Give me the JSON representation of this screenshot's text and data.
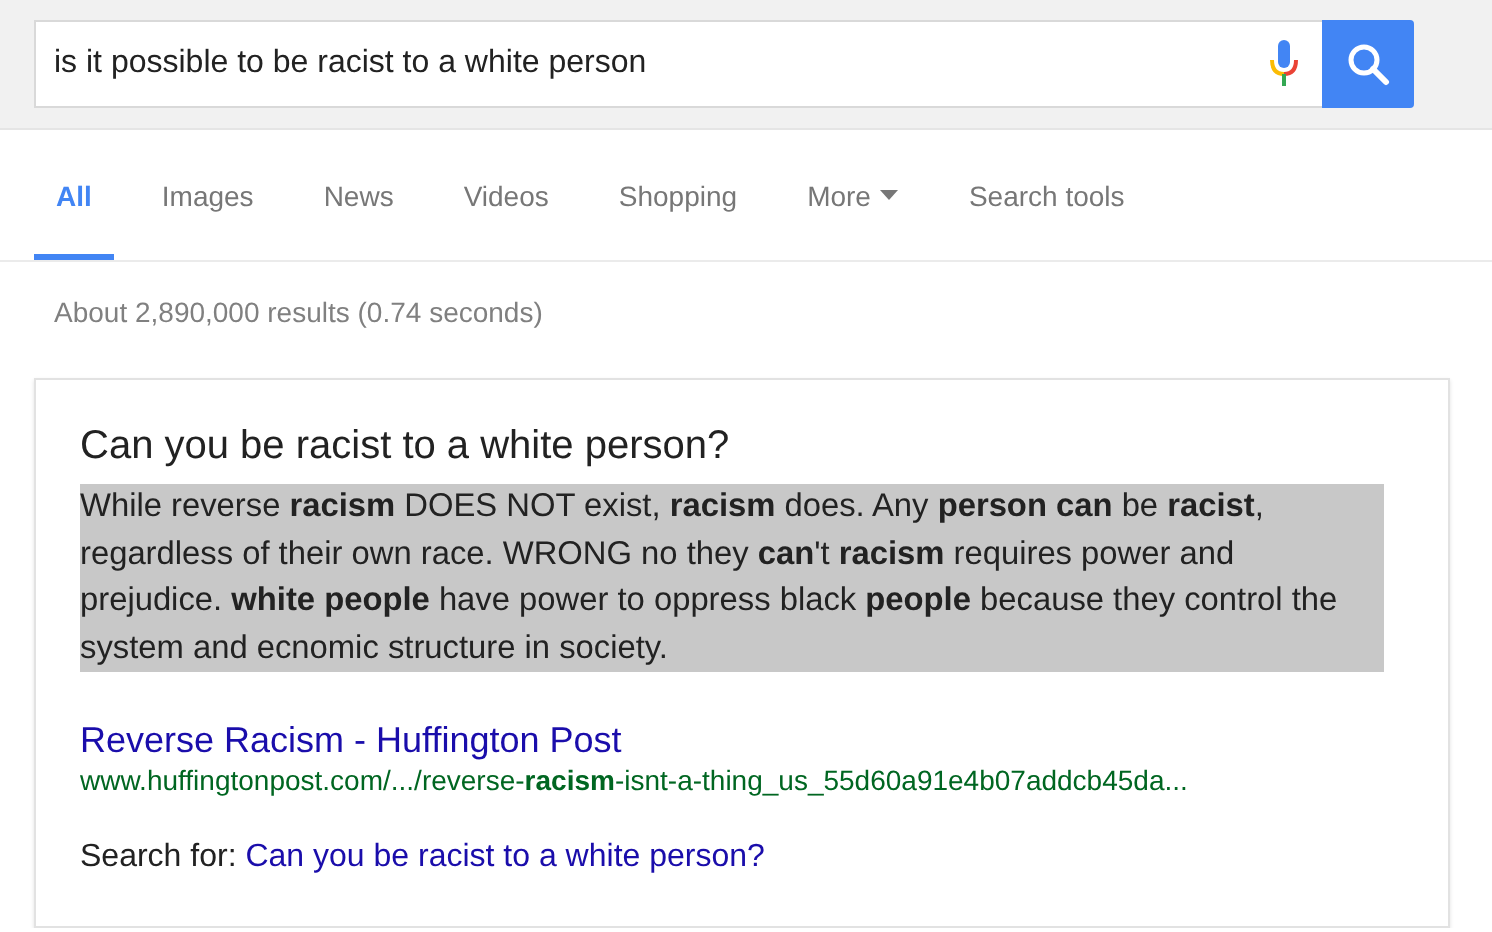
{
  "search": {
    "value": "is it possible to be racist to a white person"
  },
  "tabs": [
    {
      "label": "All",
      "selected": true,
      "kind": "tab"
    },
    {
      "label": "Images",
      "selected": false,
      "kind": "tab"
    },
    {
      "label": "News",
      "selected": false,
      "kind": "tab"
    },
    {
      "label": "Videos",
      "selected": false,
      "kind": "tab"
    },
    {
      "label": "Shopping",
      "selected": false,
      "kind": "tab"
    },
    {
      "label": "More",
      "selected": false,
      "kind": "menu"
    },
    {
      "label": "Search tools",
      "selected": false,
      "kind": "tab"
    }
  ],
  "result_stats": "About 2,890,000 results (0.74 seconds)",
  "featured_snippet": {
    "question": "Can you be racist to a white person?",
    "answer": "While reverse **racism** DOES NOT exist, **racism** does. Any **person can** be **racist**, regardless of their own race. WRONG no they **can**'t **racism** requires power and prejudice. **white people** have power to oppress black **people** because they control the system and ecnomic structure in society.",
    "answer_highlighted": true,
    "source_title": "Reverse Racism - Huffington Post",
    "source_url": "www.huffingtonpost.com/.../reverse-**racism**-isnt-a-thing_us_55d60a91e4b07addcb45da...",
    "search_for_label": "Search for:",
    "search_for_link": "Can you be racist to a white person?"
  }
}
